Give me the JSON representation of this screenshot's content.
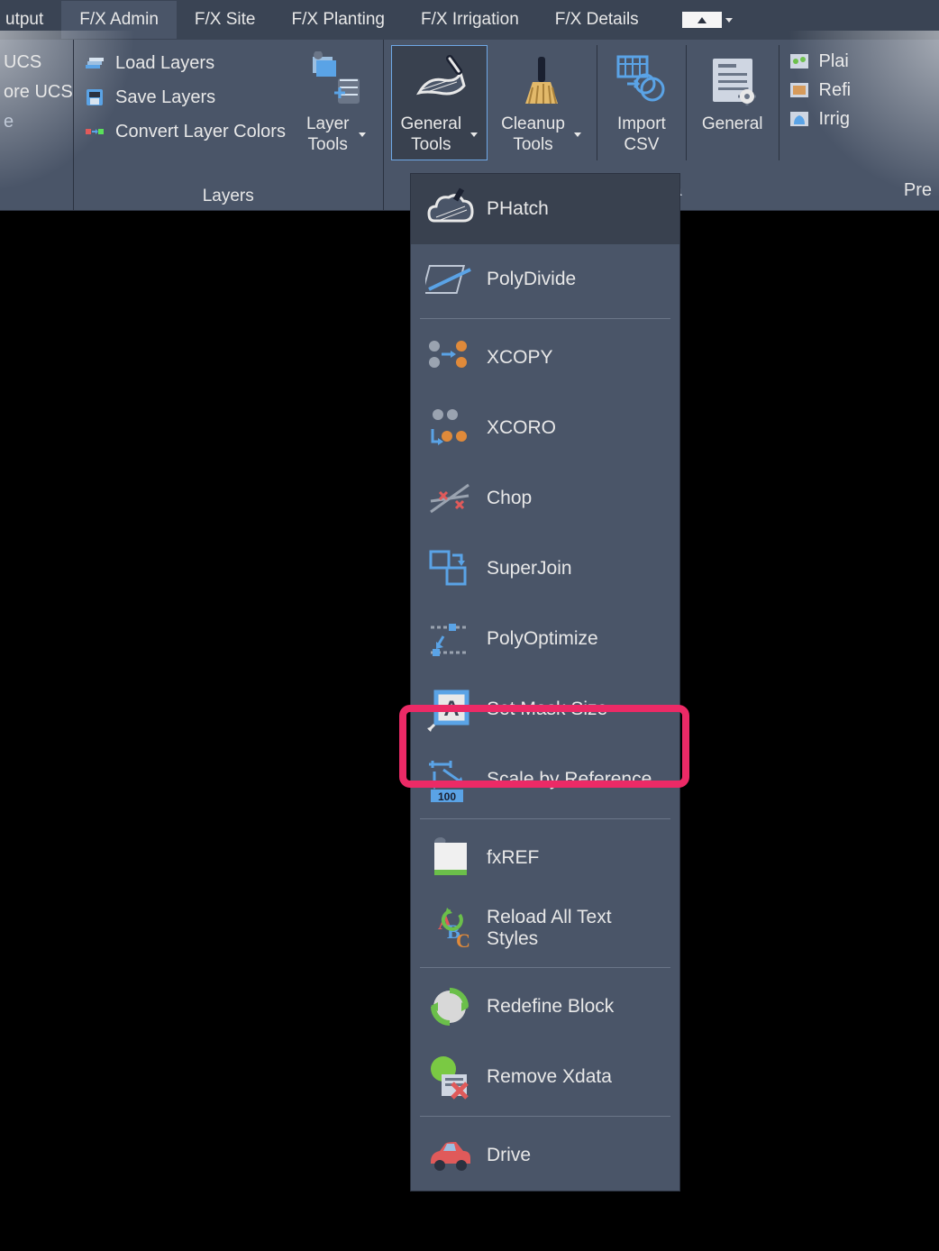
{
  "tabs": {
    "items": [
      {
        "label": "utput"
      },
      {
        "label": "F/X Admin",
        "active": true
      },
      {
        "label": "F/X Site"
      },
      {
        "label": "F/X Planting"
      },
      {
        "label": "F/X Irrigation"
      },
      {
        "label": "F/X Details"
      }
    ]
  },
  "ribbon": {
    "left_panel": {
      "items": [
        "UCS",
        "ore UCS",
        "e"
      ]
    },
    "layers_panel": {
      "title": "Layers",
      "rows": [
        {
          "label": "Load Layers"
        },
        {
          "label": "Save Layers"
        },
        {
          "label": "Convert Layer Colors"
        }
      ],
      "layer_tools": {
        "line1": "Layer",
        "line2": "Tools"
      }
    },
    "tools_panel": {
      "general": {
        "line1": "General",
        "line2": "Tools"
      },
      "cleanup": {
        "line1": "Cleanup",
        "line2": "Tools"
      },
      "import_csv": {
        "line1": "Import",
        "line2": "CSV"
      },
      "general2": "General"
    },
    "right_panel": {
      "rows": [
        {
          "label": "Plai"
        },
        {
          "label": "Refi"
        },
        {
          "label": "Irrig"
        }
      ],
      "title": "Pre"
    },
    "behind_ta": "ta"
  },
  "dropdown": {
    "groups": [
      {
        "items": [
          {
            "label": "PHatch",
            "icon": "cloud",
            "hov": true
          },
          {
            "label": "PolyDivide",
            "icon": "polydivide"
          }
        ]
      },
      {
        "items": [
          {
            "label": "XCOPY",
            "icon": "xcopy"
          },
          {
            "label": "XCORO",
            "icon": "xcoro"
          },
          {
            "label": "Chop",
            "icon": "chop"
          },
          {
            "label": "SuperJoin",
            "icon": "superjoin"
          },
          {
            "label": "PolyOptimize",
            "icon": "polyopt"
          },
          {
            "label": "Set Mask Size",
            "icon": "mask"
          },
          {
            "label": "Scale by Reference",
            "icon": "scale",
            "highlight": true
          }
        ]
      },
      {
        "items": [
          {
            "label": "fxREF",
            "icon": "fxref"
          },
          {
            "label": "Reload All Text Styles",
            "icon": "abc"
          }
        ]
      },
      {
        "items": [
          {
            "label": "Redefine Block",
            "icon": "redefine"
          },
          {
            "label": "Remove Xdata",
            "icon": "removex"
          }
        ]
      },
      {
        "items": [
          {
            "label": "Drive",
            "icon": "car"
          }
        ]
      }
    ]
  }
}
